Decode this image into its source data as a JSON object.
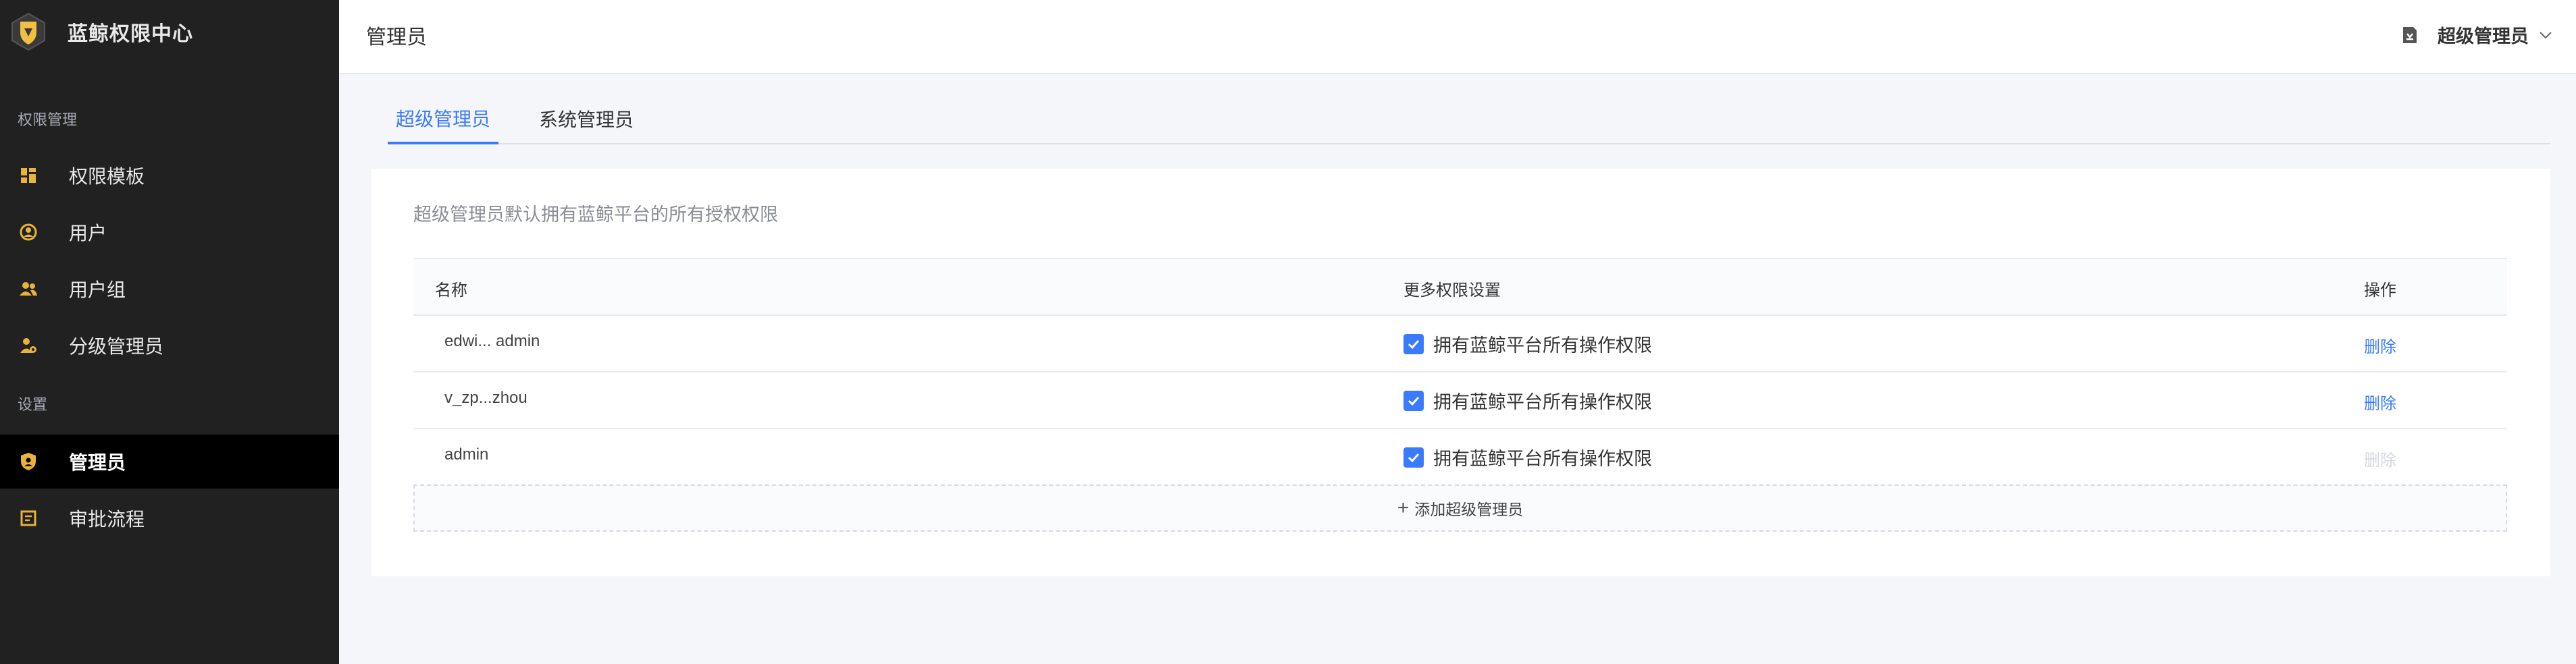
{
  "app": {
    "title": "蓝鲸权限中心"
  },
  "sidebar": {
    "groups": [
      {
        "title": "权限管理"
      },
      {
        "title": "设置"
      }
    ],
    "items": [
      {
        "label": "权限模板",
        "icon": "template-grid-icon"
      },
      {
        "label": "用户",
        "icon": "user-icon"
      },
      {
        "label": "用户组",
        "icon": "user-group-icon"
      },
      {
        "label": "分级管理员",
        "icon": "grade-admin-icon"
      },
      {
        "label": "管理员",
        "icon": "admin-shield-icon",
        "active": true
      },
      {
        "label": "审批流程",
        "icon": "approval-flow-icon"
      }
    ]
  },
  "header": {
    "page_title": "管理员",
    "user_label": "超级管理员"
  },
  "tabs": [
    {
      "label": "超级管理员",
      "active": true
    },
    {
      "label": "系统管理员",
      "active": false
    }
  ],
  "panel": {
    "description": "超级管理员默认拥有蓝鲸平台的所有授权权限",
    "columns": [
      "名称",
      "更多权限设置",
      "操作"
    ],
    "rows": [
      {
        "name": "edwi... admin",
        "permission_label": "拥有蓝鲸平台所有操作权限",
        "checked": true,
        "action": "删除",
        "action_enabled": true
      },
      {
        "name": "v_zp...zhou",
        "permission_label": "拥有蓝鲸平台所有操作权限",
        "checked": true,
        "action": "删除",
        "action_enabled": true
      },
      {
        "name": "admin",
        "permission_label": "拥有蓝鲸平台所有操作权限",
        "checked": true,
        "action": "删除",
        "action_enabled": false
      }
    ],
    "add_label": "添加超级管理员"
  },
  "colors": {
    "sidebar_bg": "#212121",
    "accent": "#3a7afe",
    "icon_gold": "#e8b33a"
  }
}
